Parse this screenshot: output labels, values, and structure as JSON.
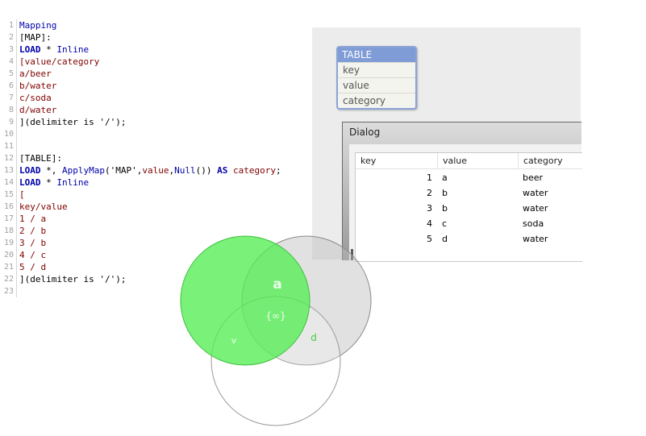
{
  "editor": {
    "lines": [
      {
        "n": "1",
        "parts": [
          {
            "t": "Mapping",
            "c": "kw"
          }
        ]
      },
      {
        "n": "2",
        "parts": [
          {
            "t": "[MAP]:",
            "c": "tx"
          }
        ]
      },
      {
        "n": "3",
        "parts": [
          {
            "t": "LOAD",
            "c": "kwb"
          },
          {
            "t": " * ",
            "c": "tx"
          },
          {
            "t": "Inline",
            "c": "kw"
          }
        ]
      },
      {
        "n": "4",
        "parts": [
          {
            "t": "[value/category",
            "c": "br"
          }
        ]
      },
      {
        "n": "5",
        "parts": [
          {
            "t": "a/beer",
            "c": "br"
          }
        ]
      },
      {
        "n": "6",
        "parts": [
          {
            "t": "b/water",
            "c": "br"
          }
        ]
      },
      {
        "n": "7",
        "parts": [
          {
            "t": "c/soda",
            "c": "br"
          }
        ]
      },
      {
        "n": "8",
        "parts": [
          {
            "t": "d/water",
            "c": "br"
          }
        ]
      },
      {
        "n": "9",
        "parts": [
          {
            "t": "](delimiter is '/');",
            "c": "tx"
          }
        ]
      },
      {
        "n": "10",
        "parts": []
      },
      {
        "n": "11",
        "parts": []
      },
      {
        "n": "12",
        "parts": [
          {
            "t": "[TABLE]:",
            "c": "tx"
          }
        ]
      },
      {
        "n": "13",
        "parts": [
          {
            "t": "LOAD",
            "c": "kwb"
          },
          {
            "t": " *, ",
            "c": "tx"
          },
          {
            "t": "ApplyMap",
            "c": "kw"
          },
          {
            "t": "('MAP',",
            "c": "tx"
          },
          {
            "t": "value",
            "c": "br"
          },
          {
            "t": ",",
            "c": "tx"
          },
          {
            "t": "Null",
            "c": "kw"
          },
          {
            "t": "()) ",
            "c": "tx"
          },
          {
            "t": "AS",
            "c": "kwb"
          },
          {
            "t": " ",
            "c": "tx"
          },
          {
            "t": "category",
            "c": "br"
          },
          {
            "t": ";",
            "c": "tx"
          }
        ]
      },
      {
        "n": "14",
        "parts": [
          {
            "t": "LOAD",
            "c": "kwb"
          },
          {
            "t": " * ",
            "c": "tx"
          },
          {
            "t": "Inline",
            "c": "kw"
          }
        ]
      },
      {
        "n": "15",
        "parts": [
          {
            "t": "[",
            "c": "br"
          }
        ]
      },
      {
        "n": "16",
        "parts": [
          {
            "t": "key/value",
            "c": "br"
          }
        ]
      },
      {
        "n": "17",
        "parts": [
          {
            "t": "1 / a",
            "c": "br"
          }
        ]
      },
      {
        "n": "18",
        "parts": [
          {
            "t": "2 / b",
            "c": "br"
          }
        ]
      },
      {
        "n": "19",
        "parts": [
          {
            "t": "3 / b",
            "c": "br"
          }
        ]
      },
      {
        "n": "20",
        "parts": [
          {
            "t": "4 / c",
            "c": "br"
          }
        ]
      },
      {
        "n": "21",
        "parts": [
          {
            "t": "5 / d",
            "c": "br"
          }
        ]
      },
      {
        "n": "22",
        "parts": [
          {
            "t": "](delimiter is '/');",
            "c": "tx"
          }
        ]
      },
      {
        "n": "23",
        "parts": []
      }
    ]
  },
  "table_box": {
    "title": "TABLE",
    "fields": [
      "key",
      "value",
      "category"
    ]
  },
  "dialog": {
    "title": "Dialog",
    "columns": [
      "key",
      "value",
      "category"
    ],
    "rows": [
      [
        "1",
        "a",
        "beer"
      ],
      [
        "2",
        "b",
        "water"
      ],
      [
        "3",
        "b",
        "water"
      ],
      [
        "4",
        "c",
        "soda"
      ],
      [
        "5",
        "d",
        "water"
      ]
    ]
  },
  "venn": {
    "label_a": "a",
    "label_null": "{∞}",
    "label_v": "v",
    "label_d": "d"
  },
  "colors": {
    "keyword": "#0000aa",
    "string": "#800000",
    "venn_green": "#66ee66",
    "table_header": "#7f9cd6"
  }
}
